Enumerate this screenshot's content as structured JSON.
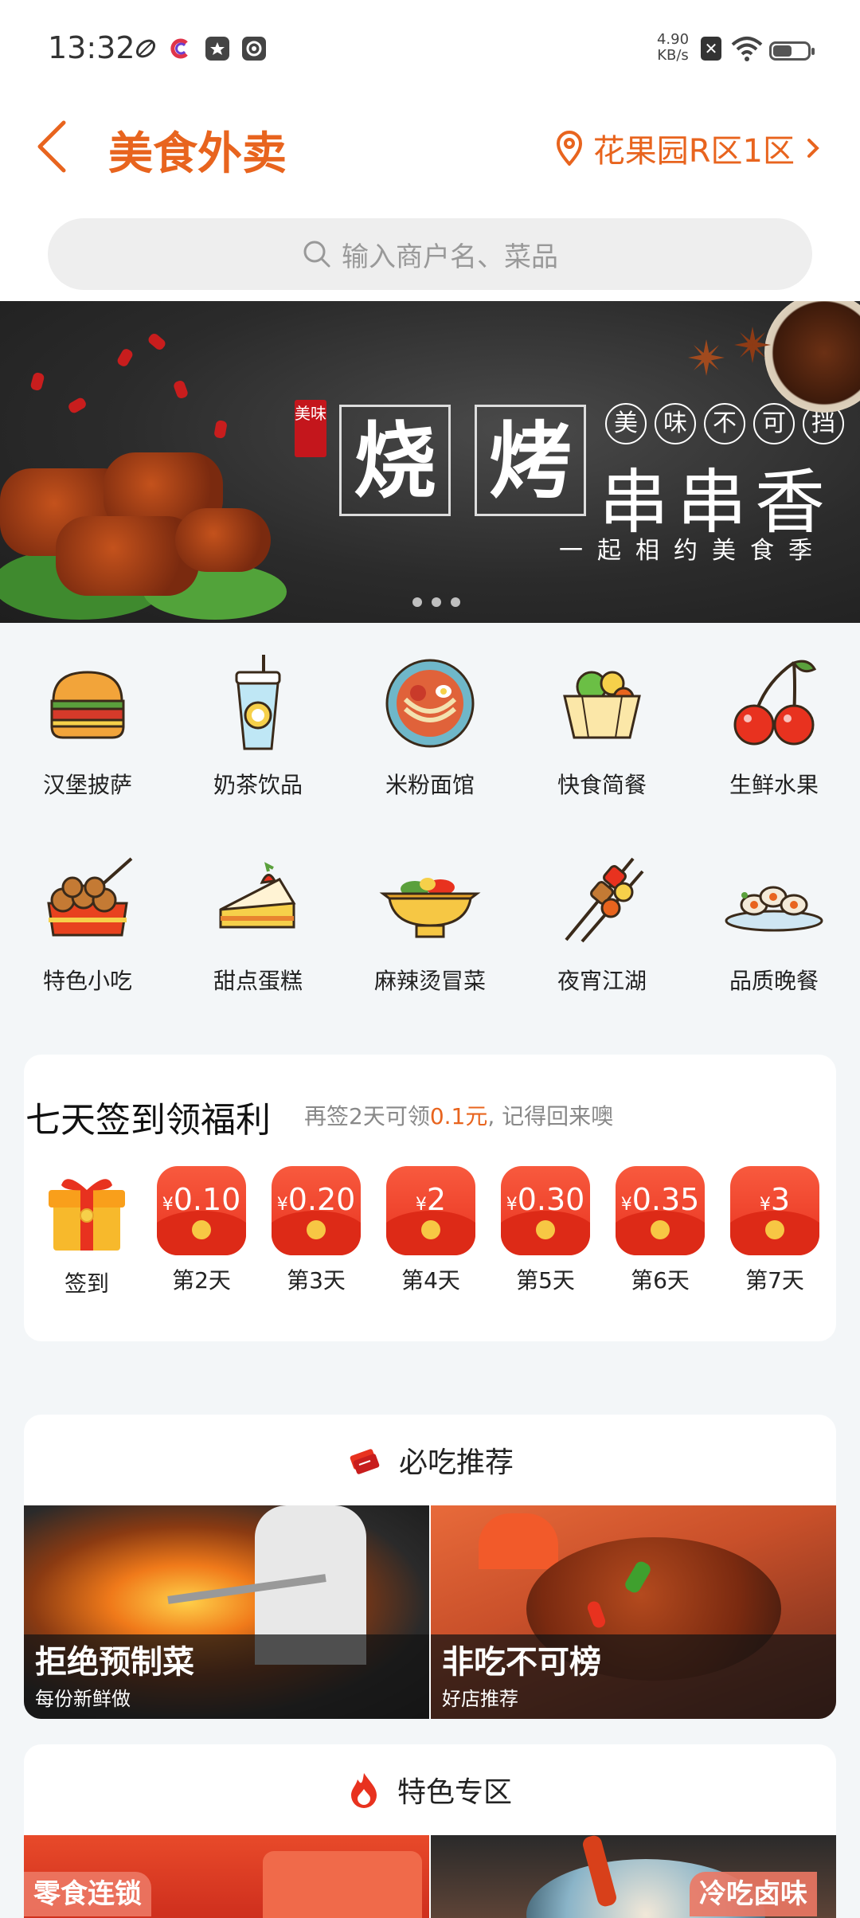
{
  "status_bar": {
    "time": "13:32",
    "net_speed_value": "4.90",
    "net_speed_unit": "KB/s",
    "battery_level": 0.55,
    "icons": [
      "leaf-icon",
      "c-app-icon",
      "star-badge-icon",
      "camera-icon",
      "notification-x-icon",
      "wifi-icon",
      "battery-icon"
    ]
  },
  "header": {
    "title": "美食外卖",
    "location": "花果园R区1区",
    "accent_color": "#e8641e"
  },
  "search": {
    "placeholder": "输入商户名、菜品"
  },
  "banner": {
    "seal": "美味",
    "big_chars": [
      "烧",
      "烤"
    ],
    "circle_chars": [
      "美",
      "味",
      "不",
      "可",
      "挡"
    ],
    "headline": "串串香",
    "slogan": "一起相约美食季",
    "dots": 3
  },
  "categories": [
    {
      "label": "汉堡披萨",
      "icon": "burger-icon"
    },
    {
      "label": "奶茶饮品",
      "icon": "milk-tea-icon"
    },
    {
      "label": "米粉面馆",
      "icon": "noodle-bowl-icon"
    },
    {
      "label": "快食简餐",
      "icon": "fast-food-icon"
    },
    {
      "label": "生鲜水果",
      "icon": "cherry-icon"
    },
    {
      "label": "特色小吃",
      "icon": "takoyaki-icon"
    },
    {
      "label": "甜点蛋糕",
      "icon": "cake-icon"
    },
    {
      "label": "麻辣烫冒菜",
      "icon": "spicy-pot-icon"
    },
    {
      "label": "夜宵江湖",
      "icon": "skewer-icon"
    },
    {
      "label": "品质晚餐",
      "icon": "seafood-platter-icon"
    }
  ],
  "checkin": {
    "title": "七天签到领福利",
    "subtitle_before": "再签2天可领",
    "subtitle_amount": "0.1元",
    "subtitle_after": ", 记得回来噢",
    "first": {
      "label": "签到"
    },
    "days": [
      {
        "currency": "¥",
        "value": "0.10",
        "label": "第2天"
      },
      {
        "currency": "¥",
        "value": "0.20",
        "label": "第3天"
      },
      {
        "currency": "¥",
        "value": "2",
        "label": "第4天"
      },
      {
        "currency": "¥",
        "value": "0.30",
        "label": "第5天"
      },
      {
        "currency": "¥",
        "value": "0.35",
        "label": "第6天"
      },
      {
        "currency": "¥",
        "value": "3",
        "label": "第7天"
      }
    ]
  },
  "must_eat": {
    "title": "必吃推荐",
    "tiles": [
      {
        "title": "拒绝预制菜",
        "subtitle": "每份新鲜做"
      },
      {
        "title": "非吃不可榜",
        "subtitle": "好店推荐"
      }
    ]
  },
  "special": {
    "title": "特色专区",
    "tiles": [
      {
        "tag": "零食连锁"
      },
      {
        "tag": "冷吃卤味"
      }
    ]
  }
}
